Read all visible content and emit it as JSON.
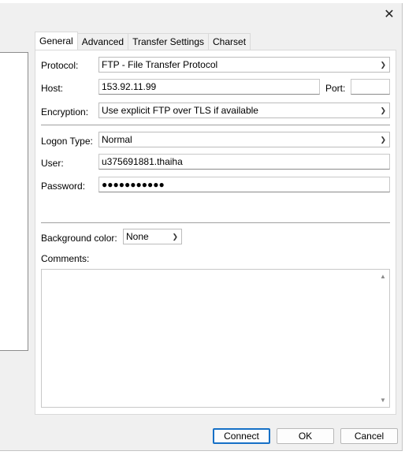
{
  "window": {
    "close_glyph": "✕"
  },
  "tabs": [
    {
      "label": "General"
    },
    {
      "label": "Advanced"
    },
    {
      "label": "Transfer Settings"
    },
    {
      "label": "Charset"
    }
  ],
  "general": {
    "protocol_label": "Protocol:",
    "protocol_value": "FTP - File Transfer Protocol",
    "host_label": "Host:",
    "host_value": "153.92.11.99",
    "port_label": "Port:",
    "port_value": "",
    "encryption_label": "Encryption:",
    "encryption_value": "Use explicit FTP over TLS if available",
    "logon_type_label": "Logon Type:",
    "logon_type_value": "Normal",
    "user_label": "User:",
    "user_value": "u375691881.thaiha",
    "password_label": "Password:",
    "password_value": "●●●●●●●●●●●",
    "background_color_label": "Background color:",
    "background_color_value": "None",
    "comments_label": "Comments:",
    "comments_value": ""
  },
  "buttons": {
    "connect": "Connect",
    "ok": "OK",
    "cancel": "Cancel"
  },
  "icons": {
    "dropdown": "chevron-down-icon",
    "scroll_up": "scroll-up-icon",
    "scroll_down": "scroll-down-icon"
  },
  "colors": {
    "default_button_border": "#1670c6"
  }
}
